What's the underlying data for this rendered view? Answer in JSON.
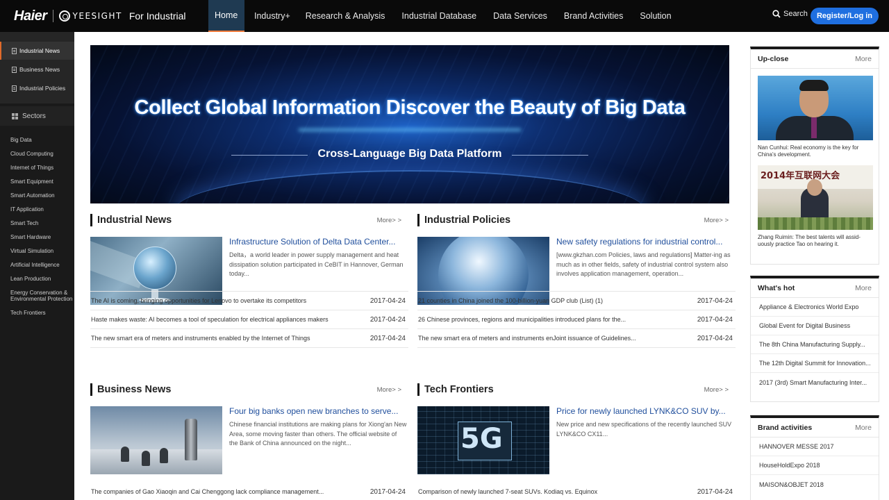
{
  "header": {
    "logo_haier": "Haier",
    "logo_yeesight": "YEESIGHT",
    "logo_suffix": "For Industrial",
    "nav": [
      "Home",
      "Industry+",
      "Research & Analysis",
      "Industrial Database",
      "Data Services",
      "Brand Activities",
      "Solution"
    ],
    "search_label": "Search",
    "login_label": "Register/Log in",
    "accent_color": "#1f6fe0"
  },
  "sidebar": {
    "top_links": [
      "Industrial News",
      "Business News",
      "Industrial Policies"
    ],
    "sectors_label": "Sectors",
    "sectors": [
      "Big Data",
      "Cloud Computing",
      "Internet of Things",
      "Smart Equipment",
      "Smart Automation",
      "IT Application",
      "Smart Tech",
      "Smart Hardware",
      "Virtual Simulation",
      "Artificial Intelligence",
      "Lean Production",
      "Energy Conservation & Environmental Protection",
      "Tech Frontiers"
    ]
  },
  "banner": {
    "title": "Collect Global Information Discover the Beauty of Big Data",
    "subtitle": "Cross-Language Big Data Platform"
  },
  "sections": {
    "industrial_news": {
      "title": "Industrial News",
      "more": "More> >",
      "feature_title": "Infrastructure Solution of Delta Data Center...",
      "feature_desc": "Delta，a world leader in power supply management and heat dissipation solution participated in CeBIT in Hannover, German today...",
      "rows": [
        {
          "text": "The AI is coming, bringing opportunities for Lenovo to overtake its competitors",
          "date": "2017-04-24"
        },
        {
          "text": "Haste makes waste: AI becomes a tool of speculation for electrical appliances makers",
          "date": "2017-04-24"
        },
        {
          "text": "The new smart era of meters and instruments enabled by the Internet of Things",
          "date": "2017-04-24"
        }
      ]
    },
    "industrial_policies": {
      "title": "Industrial Policies",
      "more": "More> >",
      "feature_title": "New safety regulations for industrial control...",
      "feature_desc": "[www.gkzhan.com  Policies, laws and regulations] Matter-ing as much as in other fields, safety of industrial control system also involves application management, operation...",
      "rows": [
        {
          "text": "21 counties in China joined the 100-billion-yuan GDP club (List) (1)",
          "date": "2017-04-24"
        },
        {
          "text": "26 Chinese provinces, regions and municipalities introduced plans for the...",
          "date": "2017-04-24"
        },
        {
          "text": "The new smart era of meters and instruments enJoint issuance of Guidelines...",
          "date": "2017-04-24"
        }
      ]
    },
    "business_news": {
      "title": "Business News",
      "more": "More> >",
      "feature_title": "Four big banks open new branches to serve...",
      "feature_desc": "Chinese financial institutions are making plans for Xiong'an New Area, some moving faster than others. The official website of the Bank of China announced on the night...",
      "rows": [
        {
          "text": "The companies of Gao Xiaoqin and Cai Chenggong lack compliance management...",
          "date": "2017-04-24"
        }
      ]
    },
    "tech_frontiers": {
      "title": "Tech Frontiers",
      "more": "More> >",
      "feature_title": "Price for newly launched LYNK&CO SUV by...",
      "feature_desc": "New price and new specifications of the recently launched SUV LYNK&CO CX11...",
      "thumb_label": "5G",
      "rows": [
        {
          "text": "Comparison of newly launched 7-seat SUVs. Kodiaq vs. Equinox",
          "date": "2017-04-24"
        }
      ]
    }
  },
  "right": {
    "upclose": {
      "title": "Up-close",
      "more": "More",
      "items": [
        {
          "caption": "Nan Cunhui: Real economy is the key for China’s development."
        },
        {
          "caption": "Zhang Ruimin: The best talents will assid-uously practice Tao on hearing it.",
          "photo_text": "2014年互联网大会"
        }
      ]
    },
    "whats_hot": {
      "title": "What's hot",
      "more": "More",
      "items": [
        "Appliance & Electronics World Expo",
        "Global Event for Digital Business",
        "The 8th China Manufacturing Supply...",
        "The 12th Digital Summit for Innovation...",
        "2017 (3rd) Smart Manufacturing Inter..."
      ]
    },
    "brand_activities": {
      "title": "Brand activities",
      "more": "More",
      "items": [
        "HANNOVER MESSE 2017",
        "HouseHoldExpo 2018",
        "MAISON&OBJET 2018"
      ]
    }
  }
}
